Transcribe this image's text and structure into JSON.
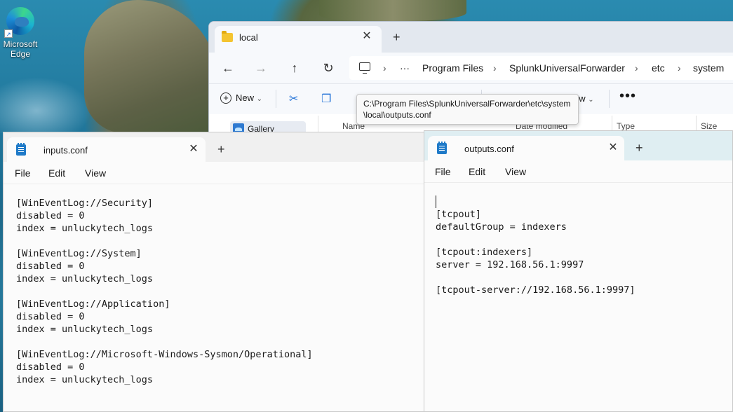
{
  "desktop": {
    "icons": [
      {
        "label": "Microsoft Edge",
        "icon": "edge-icon"
      }
    ]
  },
  "explorer": {
    "tab_title": "local",
    "breadcrumb": [
      "Program Files",
      "SplunkUniversalForwarder",
      "etc",
      "system"
    ],
    "toolbar": {
      "new_label": "New",
      "view_label": "ew"
    },
    "sidebar": {
      "gallery_label": "Gallery"
    },
    "columns": [
      "Name",
      "Date modified",
      "Type",
      "Size"
    ]
  },
  "tooltip": {
    "line1": "C:\\Program Files\\SplunkUniversalForwarder\\etc\\system",
    "line2": "\\local\\outputs.conf"
  },
  "notepad_left": {
    "tab_title": "inputs.conf",
    "menu": [
      "File",
      "Edit",
      "View"
    ],
    "content": "[WinEventLog://Security]\ndisabled = 0\nindex = unluckytech_logs\n\n[WinEventLog://System]\ndisabled = 0\nindex = unluckytech_logs\n\n[WinEventLog://Application]\ndisabled = 0\nindex = unluckytech_logs\n\n[WinEventLog://Microsoft-Windows-Sysmon/Operational]\ndisabled = 0\nindex = unluckytech_logs"
  },
  "notepad_right": {
    "tab_title": "outputs.conf",
    "menu": [
      "File",
      "Edit",
      "View"
    ],
    "content": "\n[tcpout]\ndefaultGroup = indexers\n\n[tcpout:indexers]\nserver = 192.168.56.1:9997\n\n[tcpout-server://192.168.56.1:9997]"
  }
}
